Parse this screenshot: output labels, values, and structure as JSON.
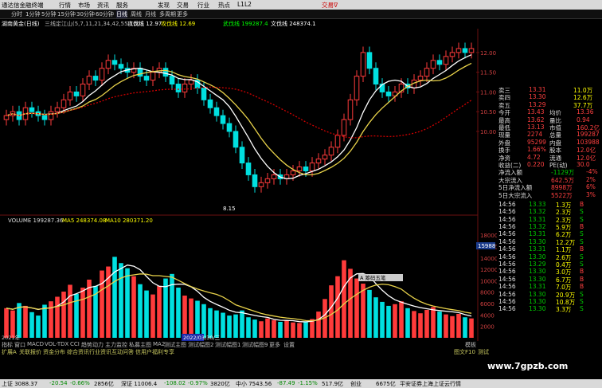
{
  "titlebar": {
    "app_title": "通达信金融终端",
    "menus": [
      "行情",
      "市场",
      "资讯",
      "服务",
      "发现",
      "交易",
      "行业",
      "热点",
      "L1L2"
    ],
    "right": "交易ᐁ"
  },
  "period_tabs": [
    "分时",
    "1分钟",
    "5分钟",
    "15分钟",
    "30分钟",
    "60分钟",
    "日线",
    "周线",
    "月线",
    "多周期",
    "更多"
  ],
  "indicator_row": {
    "stock": "湖南黄金(日线)",
    "ma_label": "三线定江山(5,7,11,21,34,42,55,120)",
    "items": [
      {
        "text": "攻伐线 12.97",
        "color": "#ffffff"
      },
      {
        "text": "攻伐线 12.69",
        "color": "#ffff00"
      },
      {
        "text": "武伐线 199287.4",
        "color": "#00ff00"
      },
      {
        "text": "文伐线 248374.1",
        "color": "#ffffff"
      }
    ]
  },
  "price_axis": [
    "12.00",
    "11.50",
    "11.00",
    "10.50",
    "10.00"
  ],
  "chart_labels": {
    "low_price": "8.15",
    "volume_title": "VOLUME 199287.36",
    "ma5": "MA5 248374.08",
    "ma10": "MA10 280371.20",
    "date_label": "2022/03/30/三",
    "vol_marker": "15988",
    "year_label": "2021年",
    "popup": "A 筹码五笔"
  },
  "volume_axis": [
    "18000",
    "16000",
    "14000",
    "12000",
    "10000",
    "8000",
    "6000",
    "4000",
    "2000"
  ],
  "quote_panel": {
    "asks": [
      [
        "卖三",
        "13.31",
        "11.0万"
      ],
      [
        "卖四",
        "13.30",
        "12.6万"
      ],
      [
        "卖五",
        "13.29",
        "37.7万"
      ]
    ],
    "stats": [
      [
        "今开",
        "13.43",
        "均价",
        "13.36"
      ],
      [
        "最高",
        "13.62",
        "量比",
        "0.94"
      ],
      [
        "最低",
        "13.13",
        "市值",
        "160.2亿"
      ],
      [
        "现量",
        "2274",
        "总量",
        "199287"
      ],
      [
        "外盘",
        "95299",
        "内盘",
        "103988"
      ],
      [
        "换手",
        "1.66%",
        "股本",
        "12.0亿"
      ],
      [
        "净资",
        "4.72",
        "流通",
        "12.0亿"
      ],
      [
        "收益(二)",
        "0.220",
        "PE(动)",
        "30.0"
      ]
    ],
    "flows": [
      [
        "净流入额",
        "-1129万",
        "-4%"
      ],
      [
        "大宗流入",
        "642.5万",
        "2%"
      ],
      [
        "5日净流入额",
        "8998万",
        "6%"
      ],
      [
        "5日大宗流入",
        "5522万",
        "3%"
      ]
    ],
    "ticks": [
      [
        "14:56",
        "13.33",
        "1.3万",
        "B"
      ],
      [
        "14:56",
        "13.32",
        "2.3万",
        "S"
      ],
      [
        "14:56",
        "13.31",
        "2.3万",
        "S"
      ],
      [
        "14:56",
        "13.32",
        "5.9万",
        "B"
      ],
      [
        "14:56",
        "13.31",
        "6.2万",
        "S"
      ],
      [
        "14:56",
        "13.30",
        "12.2万",
        "S"
      ],
      [
        "14:56",
        "13.31",
        "1.1万",
        "B"
      ],
      [
        "14:56",
        "13.30",
        "2.6万",
        "S"
      ],
      [
        "14:56",
        "13.29",
        "0.4万",
        "S"
      ],
      [
        "14:56",
        "13.30",
        "3.0万",
        "B"
      ],
      [
        "14:56",
        "13.30",
        "6.7万",
        "B"
      ],
      [
        "14:56",
        "13.31",
        "7.0万",
        "B"
      ],
      [
        "14:56",
        "13.30",
        "20.9万",
        "S"
      ],
      [
        "14:56",
        "13.30",
        "10.8万",
        "S"
      ],
      [
        "14:56",
        "13.30",
        "3.3万",
        "S"
      ]
    ]
  },
  "bottom_tabs": [
    "指标",
    "窗口",
    "MACD",
    "VOL-TDX",
    "CCI",
    "趋势动力",
    "主力监控",
    "私募主图",
    "MA2",
    "测试主图",
    "测试幅图2",
    "测试幅图1",
    "测试幅图9",
    "更多",
    "设置"
  ],
  "bottom_tabs2": [
    "扩展A",
    "关联报价",
    "资金分布",
    "综合资讯",
    "行业资讯",
    "互动问答",
    "信用户福利专享"
  ],
  "right_labels": [
    "模板",
    "图文F10",
    "测试"
  ],
  "status_bar": {
    "sh": "上证 3088.37",
    "sh_ch": "-20.54",
    "sh_pct": "-0.66%",
    "sh_amt": "2856亿",
    "sz": "深证 11006.4",
    "sz_ch": "-108.02",
    "sz_pct": "-0.97%",
    "sz_amt": "3820亿",
    "zx": "中小 7543.56",
    "zx_ch": "-87.49",
    "zx_pct": "-1.15%",
    "zx_amt": "517.9亿",
    "cy": "创业",
    "cy_amt": "6675亿",
    "notice": "平安证券上海上证云行情"
  },
  "watermark": "www.7gpzb.com",
  "colors": {
    "up": "#ff3b3b",
    "down": "#00e0e0",
    "ma_white": "#ffffff",
    "ma_yellow": "#e8d24a",
    "ma_red": "#d00000"
  },
  "chart_data": [
    {
      "type": "candlestick",
      "title": "湖南黄金(日线)",
      "ylim": [
        8.0,
        12.2
      ],
      "low_label": 8.15,
      "closes": [
        10.4,
        10.5,
        10.3,
        10.6,
        10.5,
        10.4,
        10.3,
        10.5,
        10.6,
        10.8,
        11.0,
        10.9,
        11.2,
        11.4,
        11.3,
        11.6,
        11.8,
        11.7,
        11.6,
        11.5,
        11.6,
        11.4,
        11.3,
        11.5,
        11.6,
        11.4,
        11.2,
        11.0,
        11.2,
        11.3,
        11.1,
        10.8,
        10.6,
        10.4,
        10.2,
        10.0,
        9.6,
        9.2,
        8.9,
        8.6,
        8.7,
        8.8,
        8.9,
        8.8,
        8.9,
        9.0,
        9.1,
        9.0,
        9.2,
        9.3,
        9.4,
        9.6,
        9.9,
        10.3,
        10.8,
        11.4,
        12.0,
        11.6,
        11.2,
        11.0,
        10.9,
        11.0,
        11.2,
        11.1,
        11.3,
        11.4,
        11.6,
        11.8,
        11.7,
        11.9,
        12.0,
        12.1,
        12.0,
        12.1
      ]
    },
    {
      "type": "bar",
      "title": "VOLUME",
      "ylim": [
        0,
        19000
      ],
      "values": [
        5200,
        4800,
        6100,
        5600,
        4500,
        3900,
        5800,
        6400,
        7200,
        8100,
        9300,
        7700,
        8800,
        10200,
        9100,
        11800,
        12500,
        14200,
        13100,
        12200,
        10800,
        9400,
        8300,
        7600,
        9100,
        10400,
        11200,
        8800,
        7400,
        6900,
        6500,
        5900,
        5200,
        4800,
        4400,
        3900,
        4100,
        4800,
        3600,
        3200,
        2900,
        3400,
        3100,
        2800,
        3000,
        2700,
        2600,
        2900,
        3300,
        4600,
        6800,
        9200,
        10800,
        13600,
        12100,
        10400,
        9500,
        8400,
        7100,
        6300,
        5600,
        5900,
        6400,
        5200,
        4700,
        4300,
        4900,
        5400,
        4600,
        4100,
        3800,
        4200,
        3600,
        3400
      ]
    }
  ]
}
